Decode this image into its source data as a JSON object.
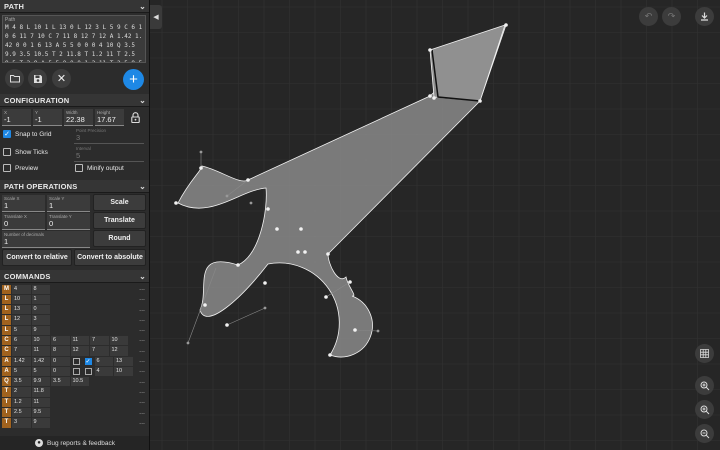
{
  "path_section": {
    "title": "PATH",
    "field_label": "Path",
    "path_text": "M 4 8 L 10 1 L 13 0 L 12 3 L 5 9 C 6 10 6 11 7 10 C 7 11 8 12 7 12 A 1.42 1.42 0 0 1 6 13 A 5 5 0 0 0 4 10 Q 3.5 9.9 3.5 10.5 T 2 11.8 T 1.2 11 T 2.5 9.5 T 3 9 A 5 5 0 0 0 1.2 11 T 2.5 9.5"
  },
  "toolbar": {
    "open_icon": "folder-icon",
    "save_icon": "save-icon",
    "clear_icon": "close-icon",
    "add_label": "+"
  },
  "configuration": {
    "title": "CONFIGURATION",
    "x_label": "X",
    "x_value": "-1",
    "y_label": "Y",
    "y_value": "-1",
    "width_label": "Width",
    "width_value": "22.38",
    "height_label": "Height",
    "height_value": "17.67",
    "snap_label": "Snap to Grid",
    "snap_checked": true,
    "point_precision_label": "Point Precision",
    "point_precision_value": "3",
    "show_ticks_label": "Show Ticks",
    "show_ticks_checked": false,
    "interval_label": "Interval",
    "interval_value": "5",
    "preview_label": "Preview",
    "preview_checked": false,
    "minify_label": "Minify output",
    "minify_checked": false
  },
  "path_operations": {
    "title": "PATH OPERATIONS",
    "scale_x_label": "Scale X",
    "scale_x_value": "1",
    "scale_y_label": "Scale Y",
    "scale_y_value": "1",
    "scale_button": "Scale",
    "translate_x_label": "Translate X",
    "translate_x_value": "0",
    "translate_y_label": "Translate Y",
    "translate_y_value": "0",
    "translate_button": "Translate",
    "decimals_label": "Number of decimals",
    "decimals_value": "1",
    "round_button": "Round",
    "relative_button": "Convert to relative",
    "absolute_button": "Convert to absolute"
  },
  "commands": {
    "title": "COMMANDS",
    "rows": [
      {
        "cmd": "M",
        "vals": [
          "4",
          "8"
        ]
      },
      {
        "cmd": "L",
        "vals": [
          "10",
          "1"
        ]
      },
      {
        "cmd": "L",
        "vals": [
          "13",
          "0"
        ]
      },
      {
        "cmd": "L",
        "vals": [
          "12",
          "3"
        ]
      },
      {
        "cmd": "L",
        "vals": [
          "5",
          "9"
        ]
      },
      {
        "cmd": "C",
        "vals": [
          "6",
          "10",
          "6",
          "11",
          "7",
          "10"
        ]
      },
      {
        "cmd": "C",
        "vals": [
          "7",
          "11",
          "8",
          "12",
          "7",
          "12"
        ]
      },
      {
        "cmd": "A",
        "vals": [
          "1.42",
          "1.42",
          "0"
        ],
        "flags": [
          false,
          true
        ],
        "end": [
          "6",
          "13"
        ]
      },
      {
        "cmd": "A",
        "vals": [
          "5",
          "5",
          "0"
        ],
        "flags": [
          false,
          false
        ],
        "end": [
          "4",
          "10"
        ]
      },
      {
        "cmd": "Q",
        "vals": [
          "3.5",
          "9.9",
          "3.5",
          "10.5"
        ]
      },
      {
        "cmd": "T",
        "vals": [
          "2",
          "11.8"
        ]
      },
      {
        "cmd": "T",
        "vals": [
          "1.2",
          "11"
        ]
      },
      {
        "cmd": "T",
        "vals": [
          "2.5",
          "9.5"
        ]
      },
      {
        "cmd": "T",
        "vals": [
          "3",
          "9"
        ]
      }
    ],
    "more_label": "..."
  },
  "footer": {
    "label": "Bug reports & feedback",
    "icon": "github-icon"
  },
  "canvas": {
    "undo_icon": "undo-icon",
    "redo_icon": "redo-icon",
    "download_icon": "download-icon",
    "grid_icon": "grid-icon",
    "zoom_in_icon": "zoom-in-icon",
    "zoom_fit_icon": "zoom-fit-icon",
    "zoom_out_icon": "zoom-out-icon",
    "collapse_icon": "chevron-left-icon"
  },
  "colors": {
    "accent": "#1e88e5",
    "command_letter": "#a0621e",
    "shape_fill": "#808080"
  }
}
